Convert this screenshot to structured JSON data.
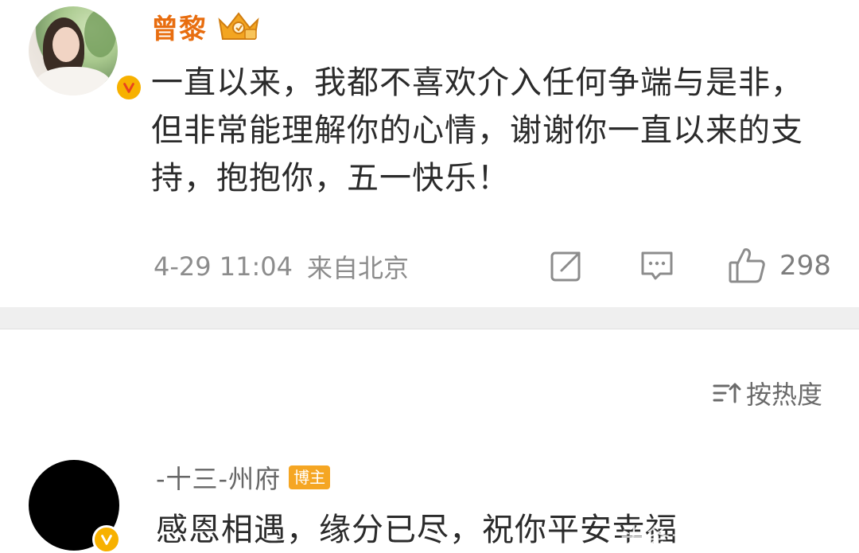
{
  "post": {
    "author": "曾黎",
    "text": "一直以来，我都不喜欢介入任何争端与是非，但非常能理解你的心情，谢谢你一直以来的支持，抱抱你，五一快乐！",
    "time": "4-29 11:04",
    "source": "来自北京",
    "like_count": "298"
  },
  "comments_section": {
    "sort_label": "按热度"
  },
  "comment": {
    "author": "-十三-州府",
    "tag": "博主",
    "text": "感恩相遇，缘分已尽，祝你平安幸福"
  },
  "watermark": "头条号",
  "colors": {
    "author_name": "#e86d0f",
    "verified_badge": "#f7b100",
    "blogger_tag": "#f5a623",
    "meta_text": "#8c8c8c",
    "divider": "#efefef"
  },
  "icons": [
    "crown-icon",
    "verified-icon",
    "repost-icon",
    "comment-icon",
    "like-icon",
    "sort-icon"
  ]
}
